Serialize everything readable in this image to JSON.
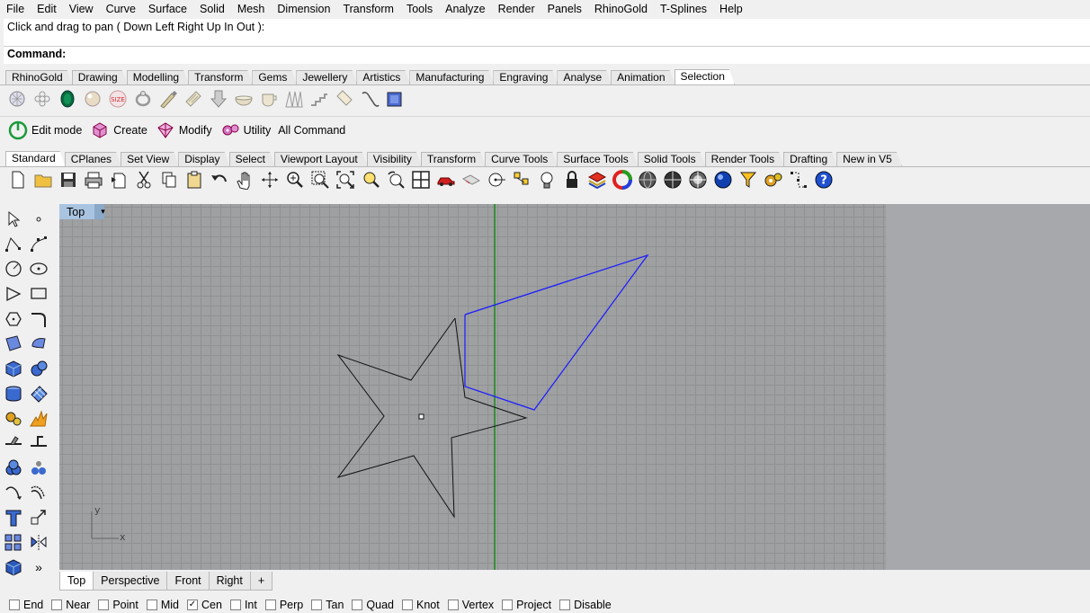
{
  "menu": [
    "File",
    "Edit",
    "View",
    "Curve",
    "Surface",
    "Solid",
    "Mesh",
    "Dimension",
    "Transform",
    "Tools",
    "Analyze",
    "Render",
    "Panels",
    "RhinoGold",
    "T-Splines",
    "Help"
  ],
  "command": {
    "history": "Click and drag to pan ( Down  Left  Right  Up  In  Out ):",
    "prompt": "Command:"
  },
  "rhinogold_tabs": [
    {
      "label": "RhinoGold",
      "active": false
    },
    {
      "label": "Drawing",
      "active": false
    },
    {
      "label": "Modelling",
      "active": false
    },
    {
      "label": "Transform",
      "active": false
    },
    {
      "label": "Gems",
      "active": false
    },
    {
      "label": "Jewellery",
      "active": false
    },
    {
      "label": "Artistics",
      "active": false
    },
    {
      "label": "Manufacturing",
      "active": false
    },
    {
      "label": "Engraving",
      "active": false
    },
    {
      "label": "Analyse",
      "active": false
    },
    {
      "label": "Animation",
      "active": false
    },
    {
      "label": "Selection",
      "active": true
    }
  ],
  "selection_icons": [
    "gem-round-icon",
    "gem-cluster-icon",
    "emerald-icon",
    "pearl-icon",
    "size-badge-icon",
    "ring-icon",
    "brush-icon",
    "paper-bundle-icon",
    "arrow-down-icon",
    "bowl-icon",
    "cup-icon",
    "spikes-icon",
    "stairs-icon",
    "tube-icon",
    "chain-link-icon",
    "box-blue-icon"
  ],
  "goldtools": {
    "edit_mode": "Edit mode",
    "create": "Create",
    "modify": "Modify",
    "utility": "Utility",
    "all_command": "All Command"
  },
  "standard_tabs": [
    {
      "label": "Standard",
      "active": true
    },
    {
      "label": "CPlanes",
      "active": false
    },
    {
      "label": "Set View",
      "active": false
    },
    {
      "label": "Display",
      "active": false
    },
    {
      "label": "Select",
      "active": false
    },
    {
      "label": "Viewport Layout",
      "active": false
    },
    {
      "label": "Visibility",
      "active": false
    },
    {
      "label": "Transform",
      "active": false
    },
    {
      "label": "Curve Tools",
      "active": false
    },
    {
      "label": "Surface Tools",
      "active": false
    },
    {
      "label": "Solid Tools",
      "active": false
    },
    {
      "label": "Render Tools",
      "active": false
    },
    {
      "label": "Drafting",
      "active": false
    },
    {
      "label": "New in V5",
      "active": false
    }
  ],
  "viewport": {
    "title": "Top",
    "dropdown": "▾",
    "axis_x": "x",
    "axis_y": "y"
  },
  "viewport_tabs": [
    {
      "label": "Top",
      "active": true
    },
    {
      "label": "Perspective",
      "active": false
    },
    {
      "label": "Front",
      "active": false
    },
    {
      "label": "Right",
      "active": false
    },
    {
      "label": "+",
      "active": false
    }
  ],
  "osnaps": [
    {
      "label": "End",
      "checked": false
    },
    {
      "label": "Near",
      "checked": false
    },
    {
      "label": "Point",
      "checked": false
    },
    {
      "label": "Mid",
      "checked": false
    },
    {
      "label": "Cen",
      "checked": true
    },
    {
      "label": "Int",
      "checked": false
    },
    {
      "label": "Perp",
      "checked": false
    },
    {
      "label": "Tan",
      "checked": false
    },
    {
      "label": "Quad",
      "checked": false
    },
    {
      "label": "Knot",
      "checked": false
    },
    {
      "label": "Vertex",
      "checked": false
    },
    {
      "label": "Project",
      "checked": false
    },
    {
      "label": "Disable",
      "checked": false
    }
  ],
  "sidebar_more": "»",
  "colors": {
    "selected_curve": "#1a1aff",
    "y_axis": "#1a8a1a",
    "viewport_bg": "#9ea0a2",
    "title_bg": "#a9c4e0"
  }
}
